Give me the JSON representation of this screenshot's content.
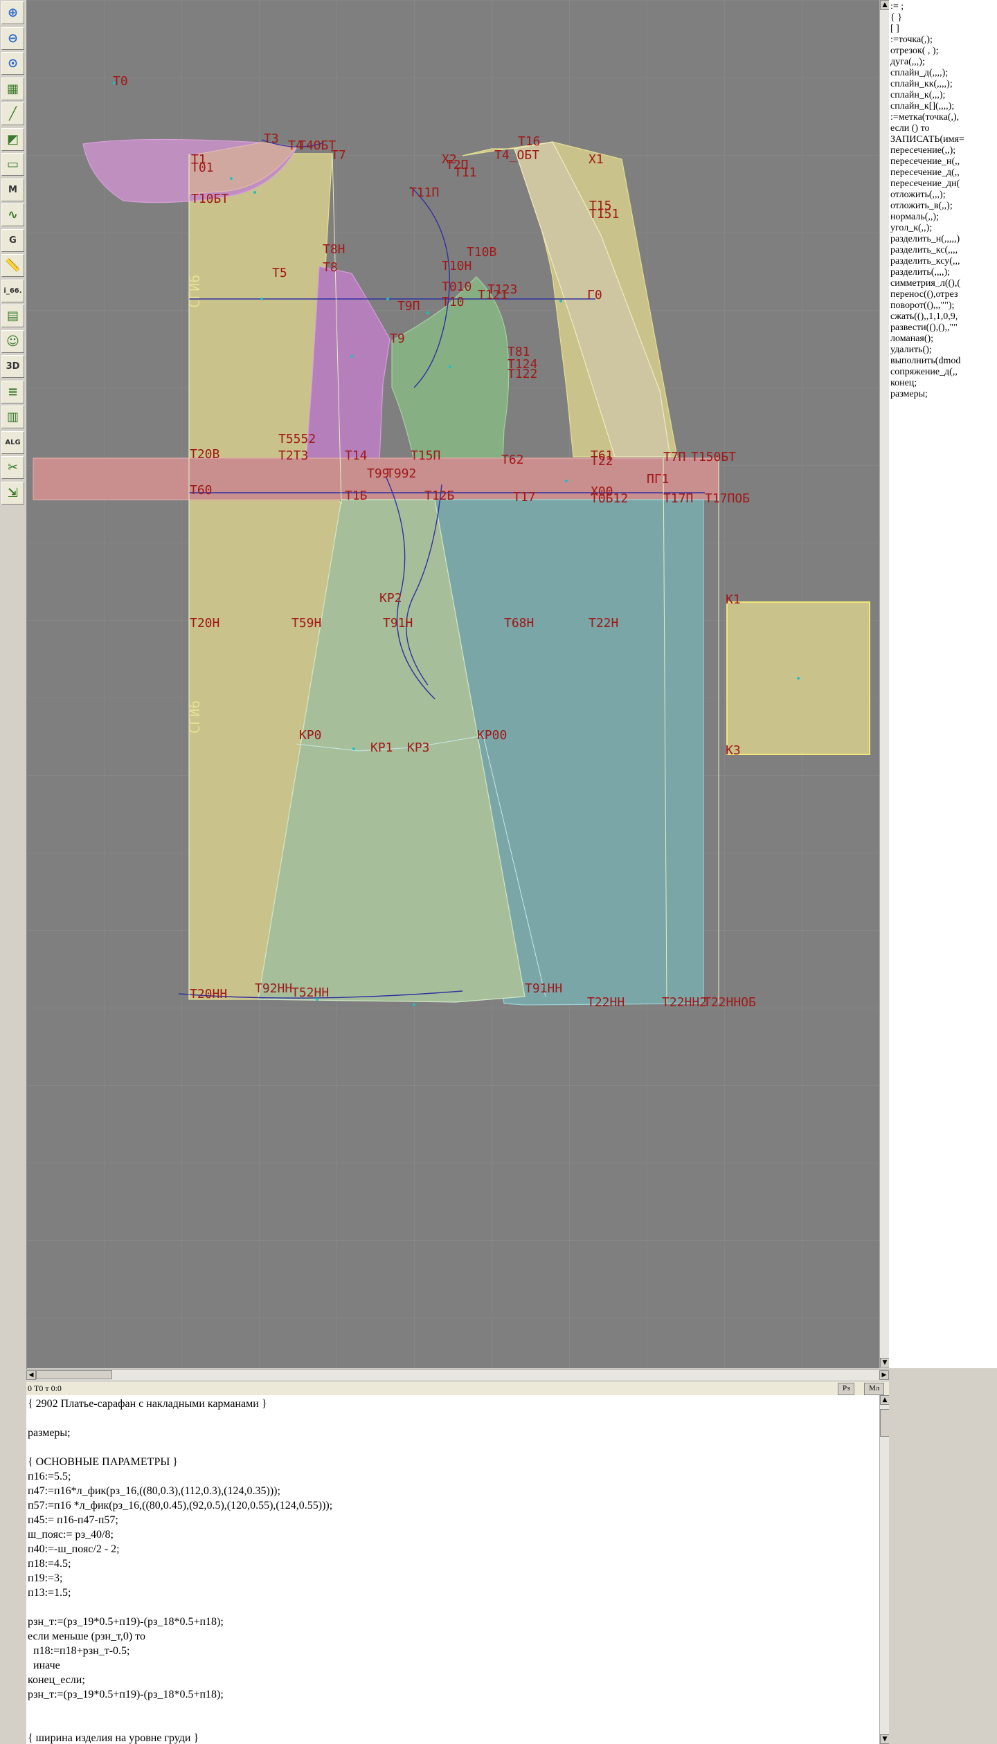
{
  "toolbar": {
    "buttons": [
      {
        "icon": "zoom-in-icon"
      },
      {
        "icon": "zoom-out-icon"
      },
      {
        "icon": "zoom-fit-icon"
      },
      {
        "icon": "grid-icon"
      },
      {
        "icon": "line-tool-icon"
      },
      {
        "icon": "layer-icon"
      },
      {
        "icon": "page-icon"
      },
      {
        "icon": "measure-icon",
        "text": "M"
      },
      {
        "icon": "curve-tool-icon"
      },
      {
        "icon": "g-tool-icon",
        "text": "G"
      },
      {
        "icon": "ruler-icon"
      },
      {
        "icon": "scale-label-icon",
        "text": "i_66."
      },
      {
        "icon": "table-icon"
      },
      {
        "icon": "avatar-icon"
      },
      {
        "icon": "view-3d-icon",
        "text": "3D"
      },
      {
        "icon": "list-icon"
      },
      {
        "icon": "stack-icon"
      },
      {
        "icon": "algorithm-icon",
        "text": "ALG"
      },
      {
        "icon": "cut-tool-icon"
      },
      {
        "icon": "export-icon"
      }
    ]
  },
  "canvas": {
    "labels": [
      "Т0",
      "Т3",
      "Т4",
      "Т4ОБТ",
      "Т7",
      "Т1",
      "Т01",
      "Т10БТ",
      "Т16",
      "Х2",
      "Т2П",
      "Т4_ОБТ",
      "Т11",
      "Х1",
      "Т11П",
      "Т15",
      "Т151",
      "Т8Н",
      "Т8",
      "Т5",
      "Т10В",
      "Т10Н",
      "Т010",
      "Т121",
      "Т123",
      "Г0",
      "СГИ6",
      "Т9П",
      "Т10",
      "Т9",
      "Т81",
      "Т124",
      "Т122",
      "Т5552",
      "Т20В",
      "Т2Т3",
      "Т14",
      "Т15П",
      "Т62",
      "Т61",
      "Т7П",
      "Т150БТ",
      "Т99",
      "Т992",
      "Т22",
      "ПГ1",
      "Т60",
      "Т1Б",
      "Т12Б",
      "Т17",
      "Х00",
      "Т0Б12",
      "Т17П",
      "Т17ПОБ",
      "КР2",
      "Т20Н",
      "Т59Н",
      "Т91Н",
      "Т68Н",
      "Т22Н",
      "К1",
      "КР0",
      "КР1",
      "КР3",
      "КР00",
      "К3",
      "Т20НН",
      "Т92НН",
      "Т52НН",
      "Т91НН",
      "Т22НН",
      "Т22НН2",
      "Т22ННОБ"
    ]
  },
  "command_panel": {
    "items": [
      ":= ;",
      "{  }",
      "[  ]",
      ":=точка(,);",
      "отрезок( , );",
      "дуга(,,,);",
      "сплайн_д(,,,,);",
      "сплайн_кк(,,,,);",
      "сплайн_к(,,,);",
      "сплайн_к[](,,,,);",
      ":=метка(точка(,),",
      "если () то",
      "ЗАПИСАТЬ(имя=",
      "пересечение(,,);",
      "пересечение_н(,,",
      "пересечение_д(,,",
      "пересечение_дн(",
      "отложить(,,,);",
      "отложить_в(,,);",
      "нормаль(,,);",
      "угол_к(,,);",
      "разделить_н(,,,,,)",
      "разделить_кс(,,,,",
      "разделить_ксу(,,,",
      "разделить(,,,,);",
      "симметрия_л((),(",
      "перенос((),отрез",
      "поворот((),,,\"\");",
      "сжать((),,1,1,0,9,",
      "развести((),(),,\"\"",
      "ломаная();",
      "удалить();",
      "выполнить(dmod",
      "сопряжение_д(,,",
      "конец;",
      "размеры;"
    ]
  },
  "status": {
    "coord": "0  Т0 т 0:0",
    "btn_rz": "Рз",
    "btn_ml": "Мл"
  },
  "code": {
    "lines": [
      "{ 2902 Платье-сарафан с накладными карманами }",
      "",
      "размеры;",
      "",
      "{ ОСНОВНЫЕ ПАРАМЕТРЫ }",
      "п16:=5.5;",
      "п47:=п16*л_фик(рз_16,((80,0.3),(112,0.3),(124,0.35)));",
      "п57:=п16 *л_фик(рз_16,((80,0.45),(92,0.5),(120,0.55),(124,0.55)));",
      "п45:= п16-п47-п57;",
      "ш_пояс:= рз_40/8;",
      "п40:=-ш_пояс/2 - 2;",
      "п18:=4.5;",
      "п19:=3;",
      "п13:=1.5;",
      "",
      "рзн_т:=(рз_19*0.5+п19)-(рз_18*0.5+п18);",
      "если меньше (рзн_т,0) то",
      "  п18:=п18+рзн_т-0.5;",
      "  иначе",
      "конец_если;",
      "рзн_т:=(рз_19*0.5+п19)-(рз_18*0.5+п18);",
      "",
      "",
      "{ ширина изделия на уровне груди }"
    ]
  }
}
